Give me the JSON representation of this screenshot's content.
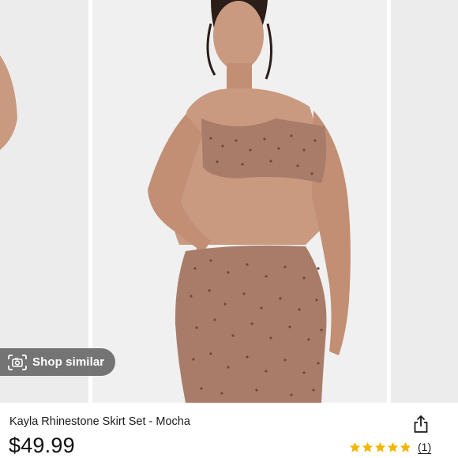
{
  "gallery": {
    "shop_similar_label": "Shop similar",
    "camera_icon": "camera-icon",
    "skin_color": "#c99a80",
    "garment_color": "#a97c6a",
    "background_color": "#f0f0f0"
  },
  "product": {
    "title": "Kayla Rhinestone Skirt Set - Mocha",
    "price": "$49.99",
    "rating": {
      "stars": 5,
      "max_stars": 5,
      "count_label": "(1)",
      "star_color": "#f2b600"
    },
    "share_icon": "share-icon"
  }
}
